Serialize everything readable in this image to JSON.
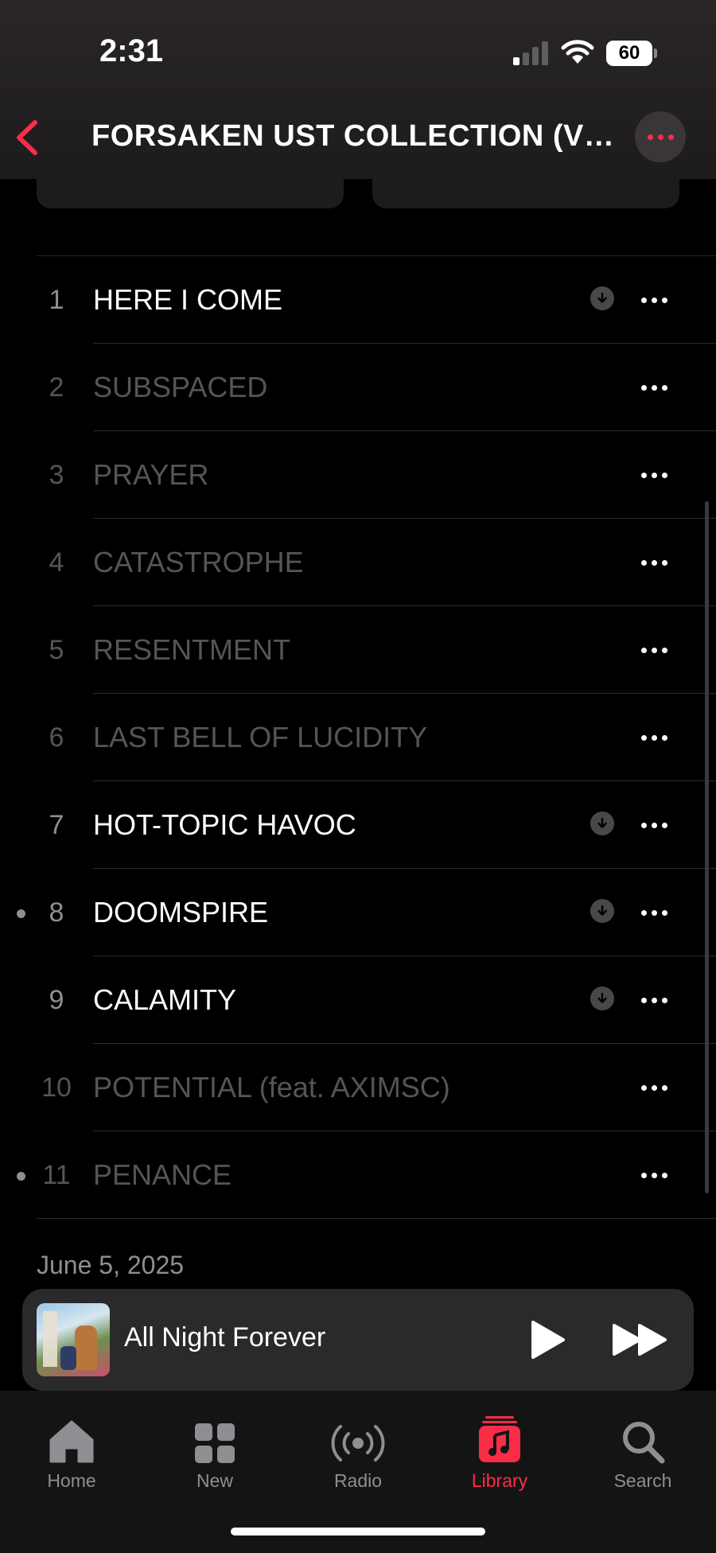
{
  "status": {
    "time": "2:31",
    "battery": "60"
  },
  "header": {
    "title": "FORSAKEN UST COLLECTION (VO..."
  },
  "tracks": [
    {
      "num": "1",
      "title": "HERE I COME",
      "available": true,
      "downloaded": true,
      "marker": false
    },
    {
      "num": "2",
      "title": "SUBSPACED",
      "available": false,
      "downloaded": false,
      "marker": false
    },
    {
      "num": "3",
      "title": "PRAYER",
      "available": false,
      "downloaded": false,
      "marker": false
    },
    {
      "num": "4",
      "title": "CATASTROPHE",
      "available": false,
      "downloaded": false,
      "marker": false
    },
    {
      "num": "5",
      "title": "RESENTMENT",
      "available": false,
      "downloaded": false,
      "marker": false
    },
    {
      "num": "6",
      "title": "LAST BELL OF LUCIDITY",
      "available": false,
      "downloaded": false,
      "marker": false
    },
    {
      "num": "7",
      "title": "HOT-TOPIC HAVOC",
      "available": true,
      "downloaded": true,
      "marker": false
    },
    {
      "num": "8",
      "title": "DOOMSPIRE",
      "available": true,
      "downloaded": true,
      "marker": true
    },
    {
      "num": "9",
      "title": "CALAMITY",
      "available": true,
      "downloaded": true,
      "marker": false
    },
    {
      "num": "10",
      "title": "POTENTIAL (feat. AXIMSC)",
      "available": false,
      "downloaded": false,
      "marker": false
    },
    {
      "num": "11",
      "title": "PENANCE",
      "available": false,
      "downloaded": false,
      "marker": true
    }
  ],
  "release_date": "June 5, 2025",
  "now_playing": {
    "title": "All Night Forever"
  },
  "tabs": [
    {
      "label": "Home",
      "icon": "home-icon",
      "active": false
    },
    {
      "label": "New",
      "icon": "grid-icon",
      "active": false
    },
    {
      "label": "Radio",
      "icon": "radio-icon",
      "active": false
    },
    {
      "label": "Library",
      "icon": "music-note-icon",
      "active": true
    },
    {
      "label": "Search",
      "icon": "search-icon",
      "active": false
    }
  ],
  "colors": {
    "accent": "#fa2d48",
    "background": "#000000",
    "secondary_text": "#8e8e93",
    "dimmed_text": "#555558"
  }
}
